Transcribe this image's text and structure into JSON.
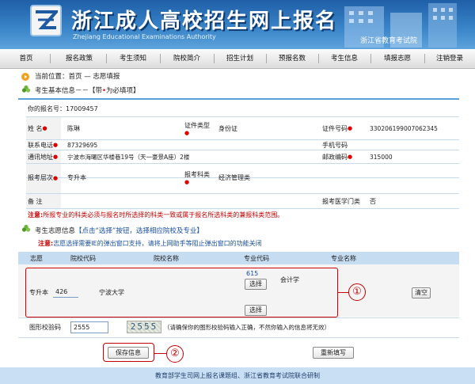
{
  "header": {
    "title": "浙江成人高校招生网上报名",
    "subtitle": "Zhejiang Educational Examinations Authority",
    "authority": "浙江省教育考试院"
  },
  "nav": [
    "首页",
    "报名政策",
    "考生须知",
    "院校简介",
    "招生计划",
    "预报名数",
    "考生信息",
    "填报志愿",
    "注销登录"
  ],
  "breadcrumb": "当前位置：首页 — 志愿填报",
  "basic": {
    "heading_prefix": "考生基本信息－－【带",
    "heading_suffix": "为必填项】",
    "reg_no_label": "你的报名号：",
    "reg_no": "17009457",
    "name_label": "姓 名",
    "name": "陈琳",
    "idtype_label": "证件类型",
    "idtype": "身份证",
    "idno_label": "证件号码",
    "idno": "330206199007062345",
    "phone_label": "联系电话",
    "phone": "87329695",
    "mobile_label": "手机号码",
    "mobile": "",
    "addr_label": "通讯地址",
    "addr": "宁波市海曙区华楼巷19号（天一豪景A座）2楼",
    "zip_label": "邮政编码",
    "zip": "315000",
    "level_label": "报考层次",
    "level": "专升本",
    "subject_label": "报考科类",
    "subject": "经济管理类",
    "remark_label": "备 注",
    "medical_label": "报考医学门类",
    "medical": "否"
  },
  "note1_label": "注意:",
  "note1": "所报专业的科类必须与报名时所选择的科类一致或属于报名所选科类的兼报科类范围。",
  "wish": {
    "heading_prefix": "考生志愿信息",
    "heading_hint": "【点击“选择”按钮，选择相应院校及专业】",
    "note_label": "注意:",
    "note": "志愿选择需要IE的弹出窗口支持，请将上网助手等阻止弹出窗口的功能关闭",
    "col_wish": "志愿",
    "col_school_code": "院校代码",
    "col_school_name": "院校名称",
    "col_major_code": "专业代码",
    "col_major_name": "专业名称",
    "row_level": "专升本",
    "school_code": "426",
    "school_name": "宁波大学",
    "major_code": "615",
    "major_name": "会计学",
    "select_btn": "选择",
    "select_btn2": "选择",
    "clear_btn": "清空",
    "callout1": "①"
  },
  "captcha": {
    "label": "图形校验码",
    "value": "2555",
    "image_text": "2555",
    "hint": "（请确保你的图形校验码输入正确，不然你输入的信息将无效）"
  },
  "actions": {
    "save": "保存信息",
    "reset": "重新填写",
    "callout2": "②"
  },
  "footer": "教育部学生司网上报名课题组、浙江省教育考试院联合研制",
  "colors": {
    "banner": "#2f78c0",
    "accent_red": "#d00000",
    "callout": "#c00000"
  }
}
